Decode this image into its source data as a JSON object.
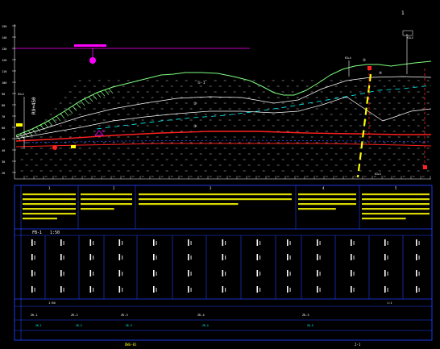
{
  "drawing": {
    "section_label": "R9+450",
    "scale_left": "1:50",
    "scale_right": "1:1",
    "top_marker": "1",
    "bh_labels": [
      "K3+4",
      "K3+4",
      "K3+4",
      "K3+4"
    ],
    "elev_ticks": [
      "150",
      "140",
      "130",
      "120",
      "110",
      "100",
      "90",
      "80",
      "70",
      "60",
      "50",
      "40",
      "30",
      "20"
    ],
    "layer_labels": [
      "①-1",
      "②",
      "③",
      "④",
      "⑤",
      "⑥"
    ],
    "table_columns": [
      "1",
      "2",
      "3",
      "4",
      "5"
    ],
    "row_labels": [
      "FB-1",
      "1:50"
    ],
    "bottom_labels": [
      "ZK-1",
      "ZK-2",
      "ZK-3",
      "ZK-4",
      "ZK-5"
    ],
    "footer_left": "DWG-01",
    "footer_right": "2-1"
  },
  "colors": {
    "background": "#000000",
    "ground_line": "#7fff7f",
    "grid": "#ffffff",
    "stratum": "#ffffff",
    "cyan": "#00ffff",
    "red": "#ff2020",
    "magenta": "#ff00ff",
    "yellow": "#ffff00",
    "blue": "#2040ff"
  }
}
